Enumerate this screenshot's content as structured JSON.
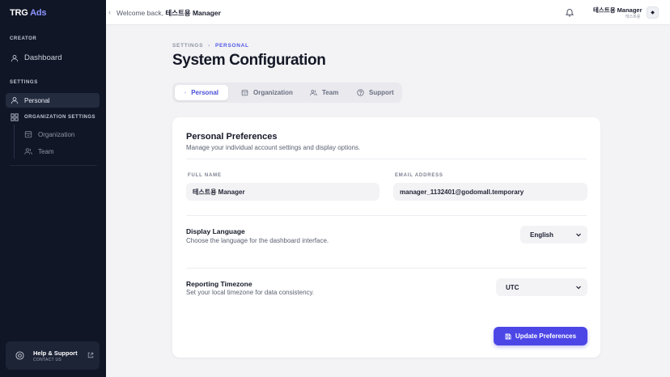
{
  "brand": {
    "name": "TRG",
    "accent": "Ads"
  },
  "sidebar": {
    "creator_label": "CREATOR",
    "dashboard_label": "Dashboard",
    "settings_label": "SETTINGS",
    "personal_label": "Personal",
    "org_settings_label": "ORGANIZATION SETTINGS",
    "organization_label": "Organization",
    "team_label": "Team",
    "help_title": "Help & Support",
    "help_sub": "CONTACT US"
  },
  "topbar": {
    "welcome_prefix": "Welcome back,",
    "welcome_name": "테스트용 Manager",
    "user_name": "테스트용 Manager",
    "user_role": "테스트용",
    "collapse_glyph": "‹",
    "avatar_glyph": "◆"
  },
  "breadcrumb": {
    "root": "SETTINGS",
    "sep": "›",
    "current": "PERSONAL"
  },
  "page": {
    "title": "System Configuration"
  },
  "tabs": [
    {
      "label": "Personal",
      "icon": "user-icon"
    },
    {
      "label": "Organization",
      "icon": "building-icon"
    },
    {
      "label": "Team",
      "icon": "users-icon"
    },
    {
      "label": "Support",
      "icon": "help-circle-icon"
    }
  ],
  "card": {
    "title": "Personal Preferences",
    "subtitle": "Manage your individual account settings and display options.",
    "full_name_label": "FULL NAME",
    "full_name_value": "테스트용 Manager",
    "email_label": "EMAIL ADDRESS",
    "email_value": "manager_1132401@godomall.temporary",
    "language_title": "Display Language",
    "language_sub": "Choose the language for the dashboard interface.",
    "language_value": "English",
    "timezone_title": "Reporting Timezone",
    "timezone_sub": "Set your local timezone for data consistency.",
    "timezone_value": "UTC",
    "update_label": "Update Preferences"
  },
  "colors": {
    "accent": "#4c46e6",
    "sidebar_bg": "#101626"
  }
}
